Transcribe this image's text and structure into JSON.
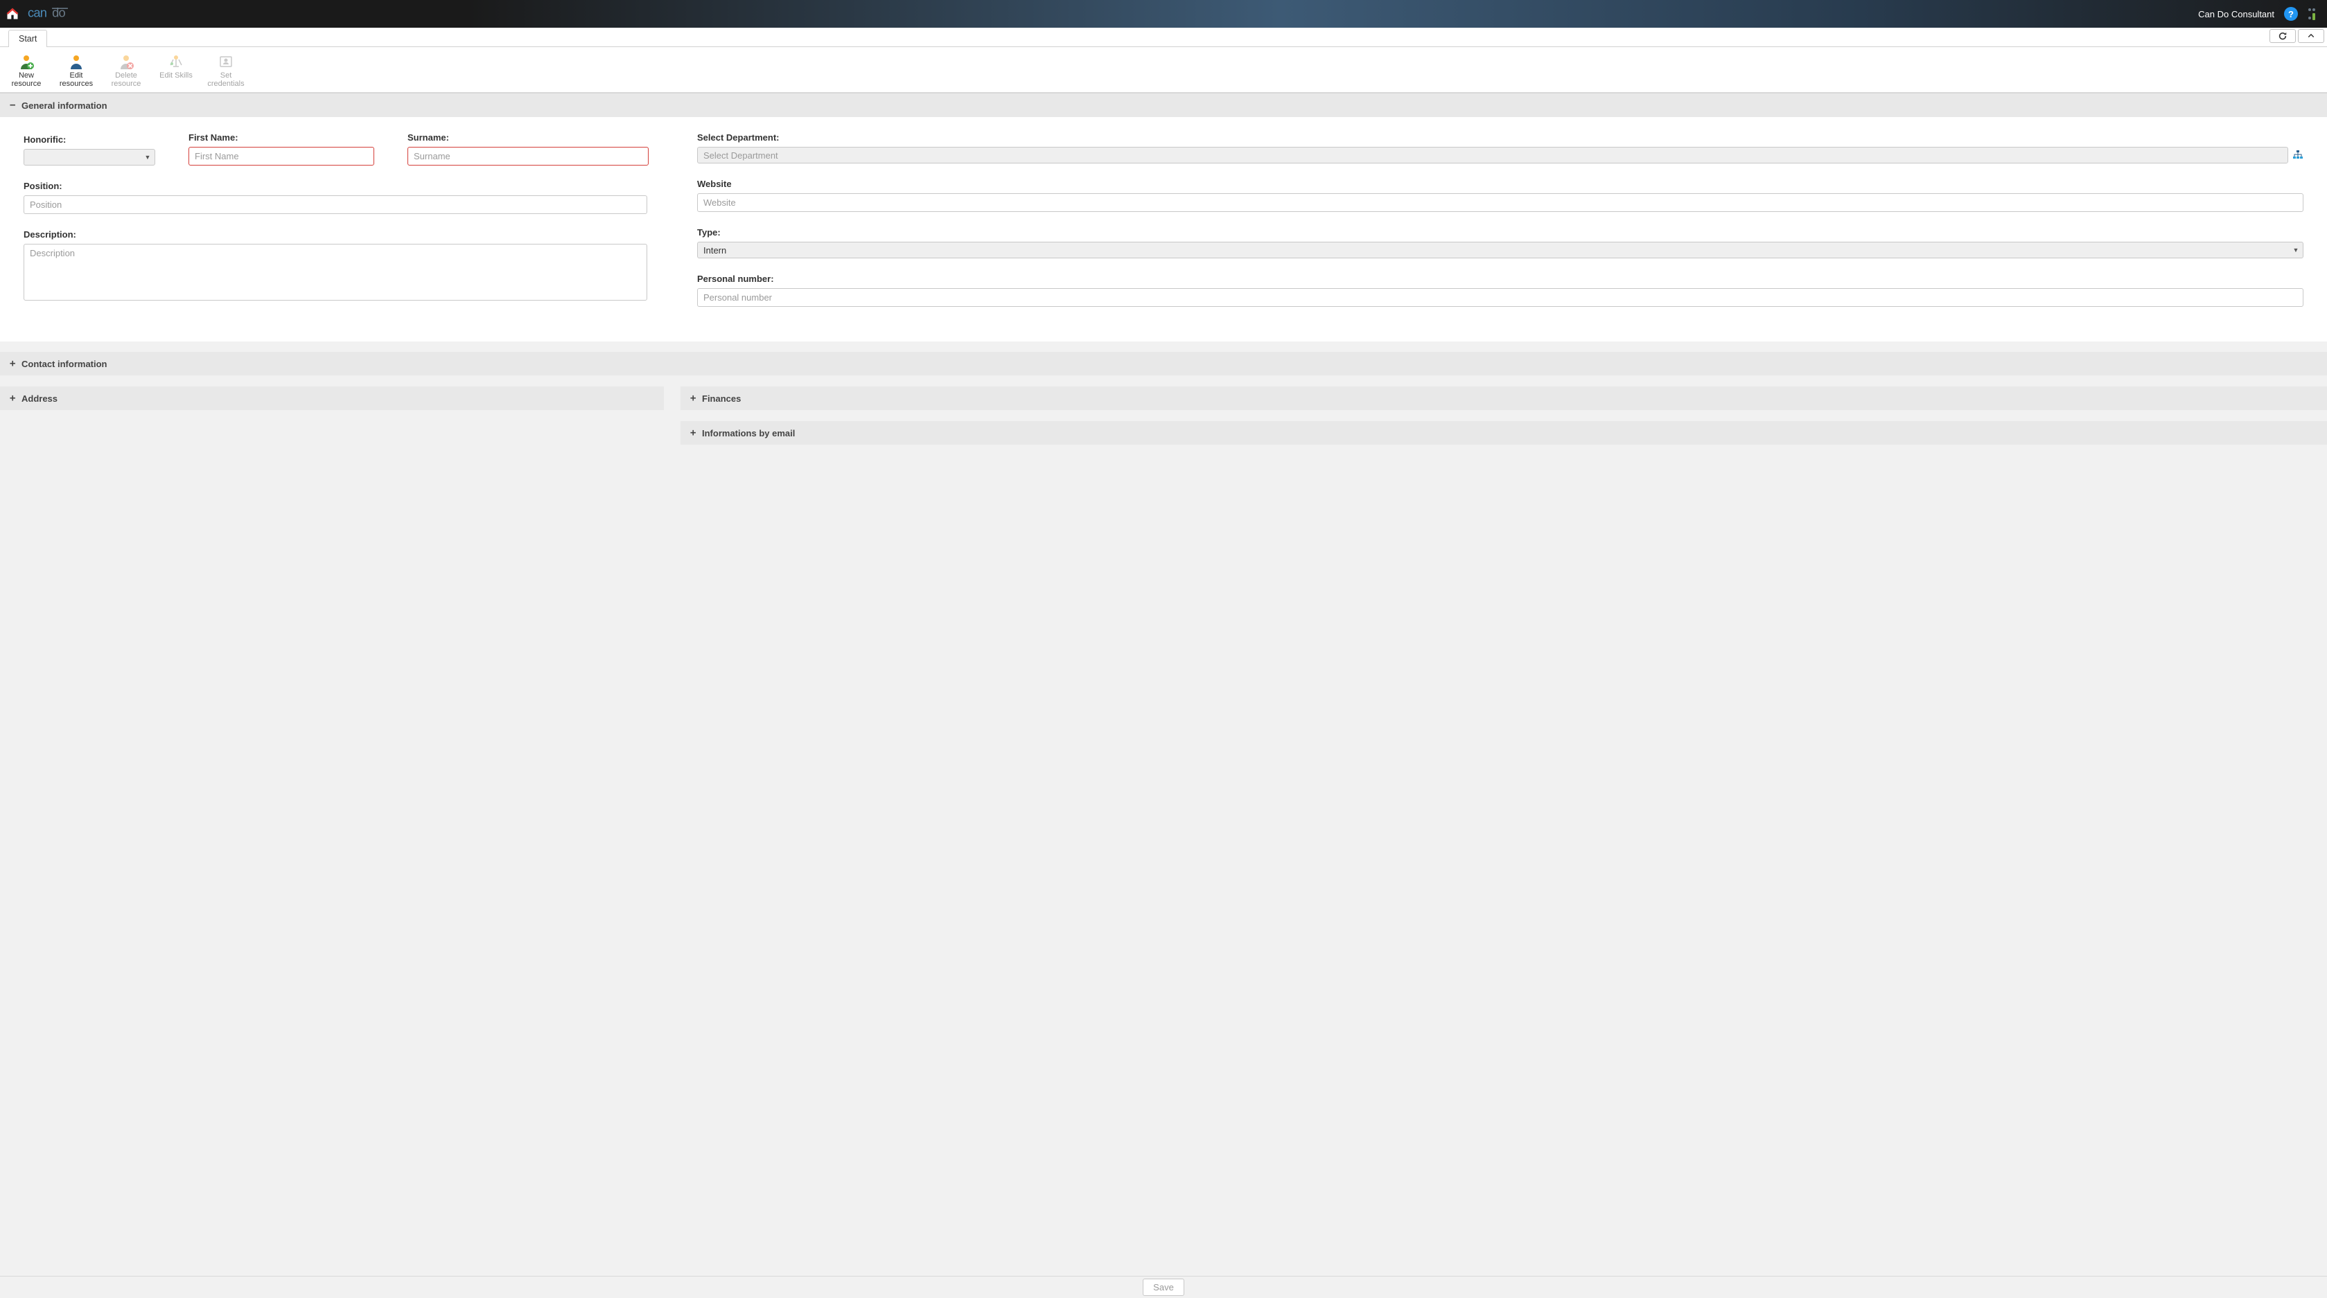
{
  "header": {
    "user_name": "Can Do Consultant"
  },
  "tabs": {
    "start": "Start"
  },
  "toolbar": {
    "new_resource": "New\nresource",
    "edit_resources": "Edit\nresources",
    "delete_resource": "Delete\nresource",
    "edit_skills": "Edit Skills",
    "set_credentials": "Set\ncredentials"
  },
  "sections": {
    "general": {
      "title": "General information",
      "expanded": true
    },
    "contact": {
      "title": "Contact information",
      "expanded": false
    },
    "address": {
      "title": "Address",
      "expanded": false
    },
    "finances": {
      "title": "Finances",
      "expanded": false
    },
    "email_info": {
      "title": "Informations by email",
      "expanded": false
    }
  },
  "form": {
    "honorific": {
      "label": "Honorific:",
      "value": ""
    },
    "first_name": {
      "label": "First Name:",
      "placeholder": "First Name",
      "value": ""
    },
    "surname": {
      "label": "Surname:",
      "placeholder": "Surname",
      "value": ""
    },
    "position": {
      "label": "Position:",
      "placeholder": "Position",
      "value": ""
    },
    "description": {
      "label": "Description:",
      "placeholder": "Description",
      "value": ""
    },
    "department": {
      "label": "Select Department:",
      "placeholder": "Select Department",
      "value": ""
    },
    "website": {
      "label": "Website",
      "placeholder": "Website",
      "value": ""
    },
    "type": {
      "label": "Type:",
      "value": "Intern"
    },
    "personal_number": {
      "label": "Personal number:",
      "placeholder": "Personal number",
      "value": ""
    }
  },
  "footer": {
    "save": "Save"
  },
  "icons": {
    "home": "home-icon",
    "help": "?",
    "refresh": "refresh-icon",
    "collapse": "chevron-up-icon"
  }
}
